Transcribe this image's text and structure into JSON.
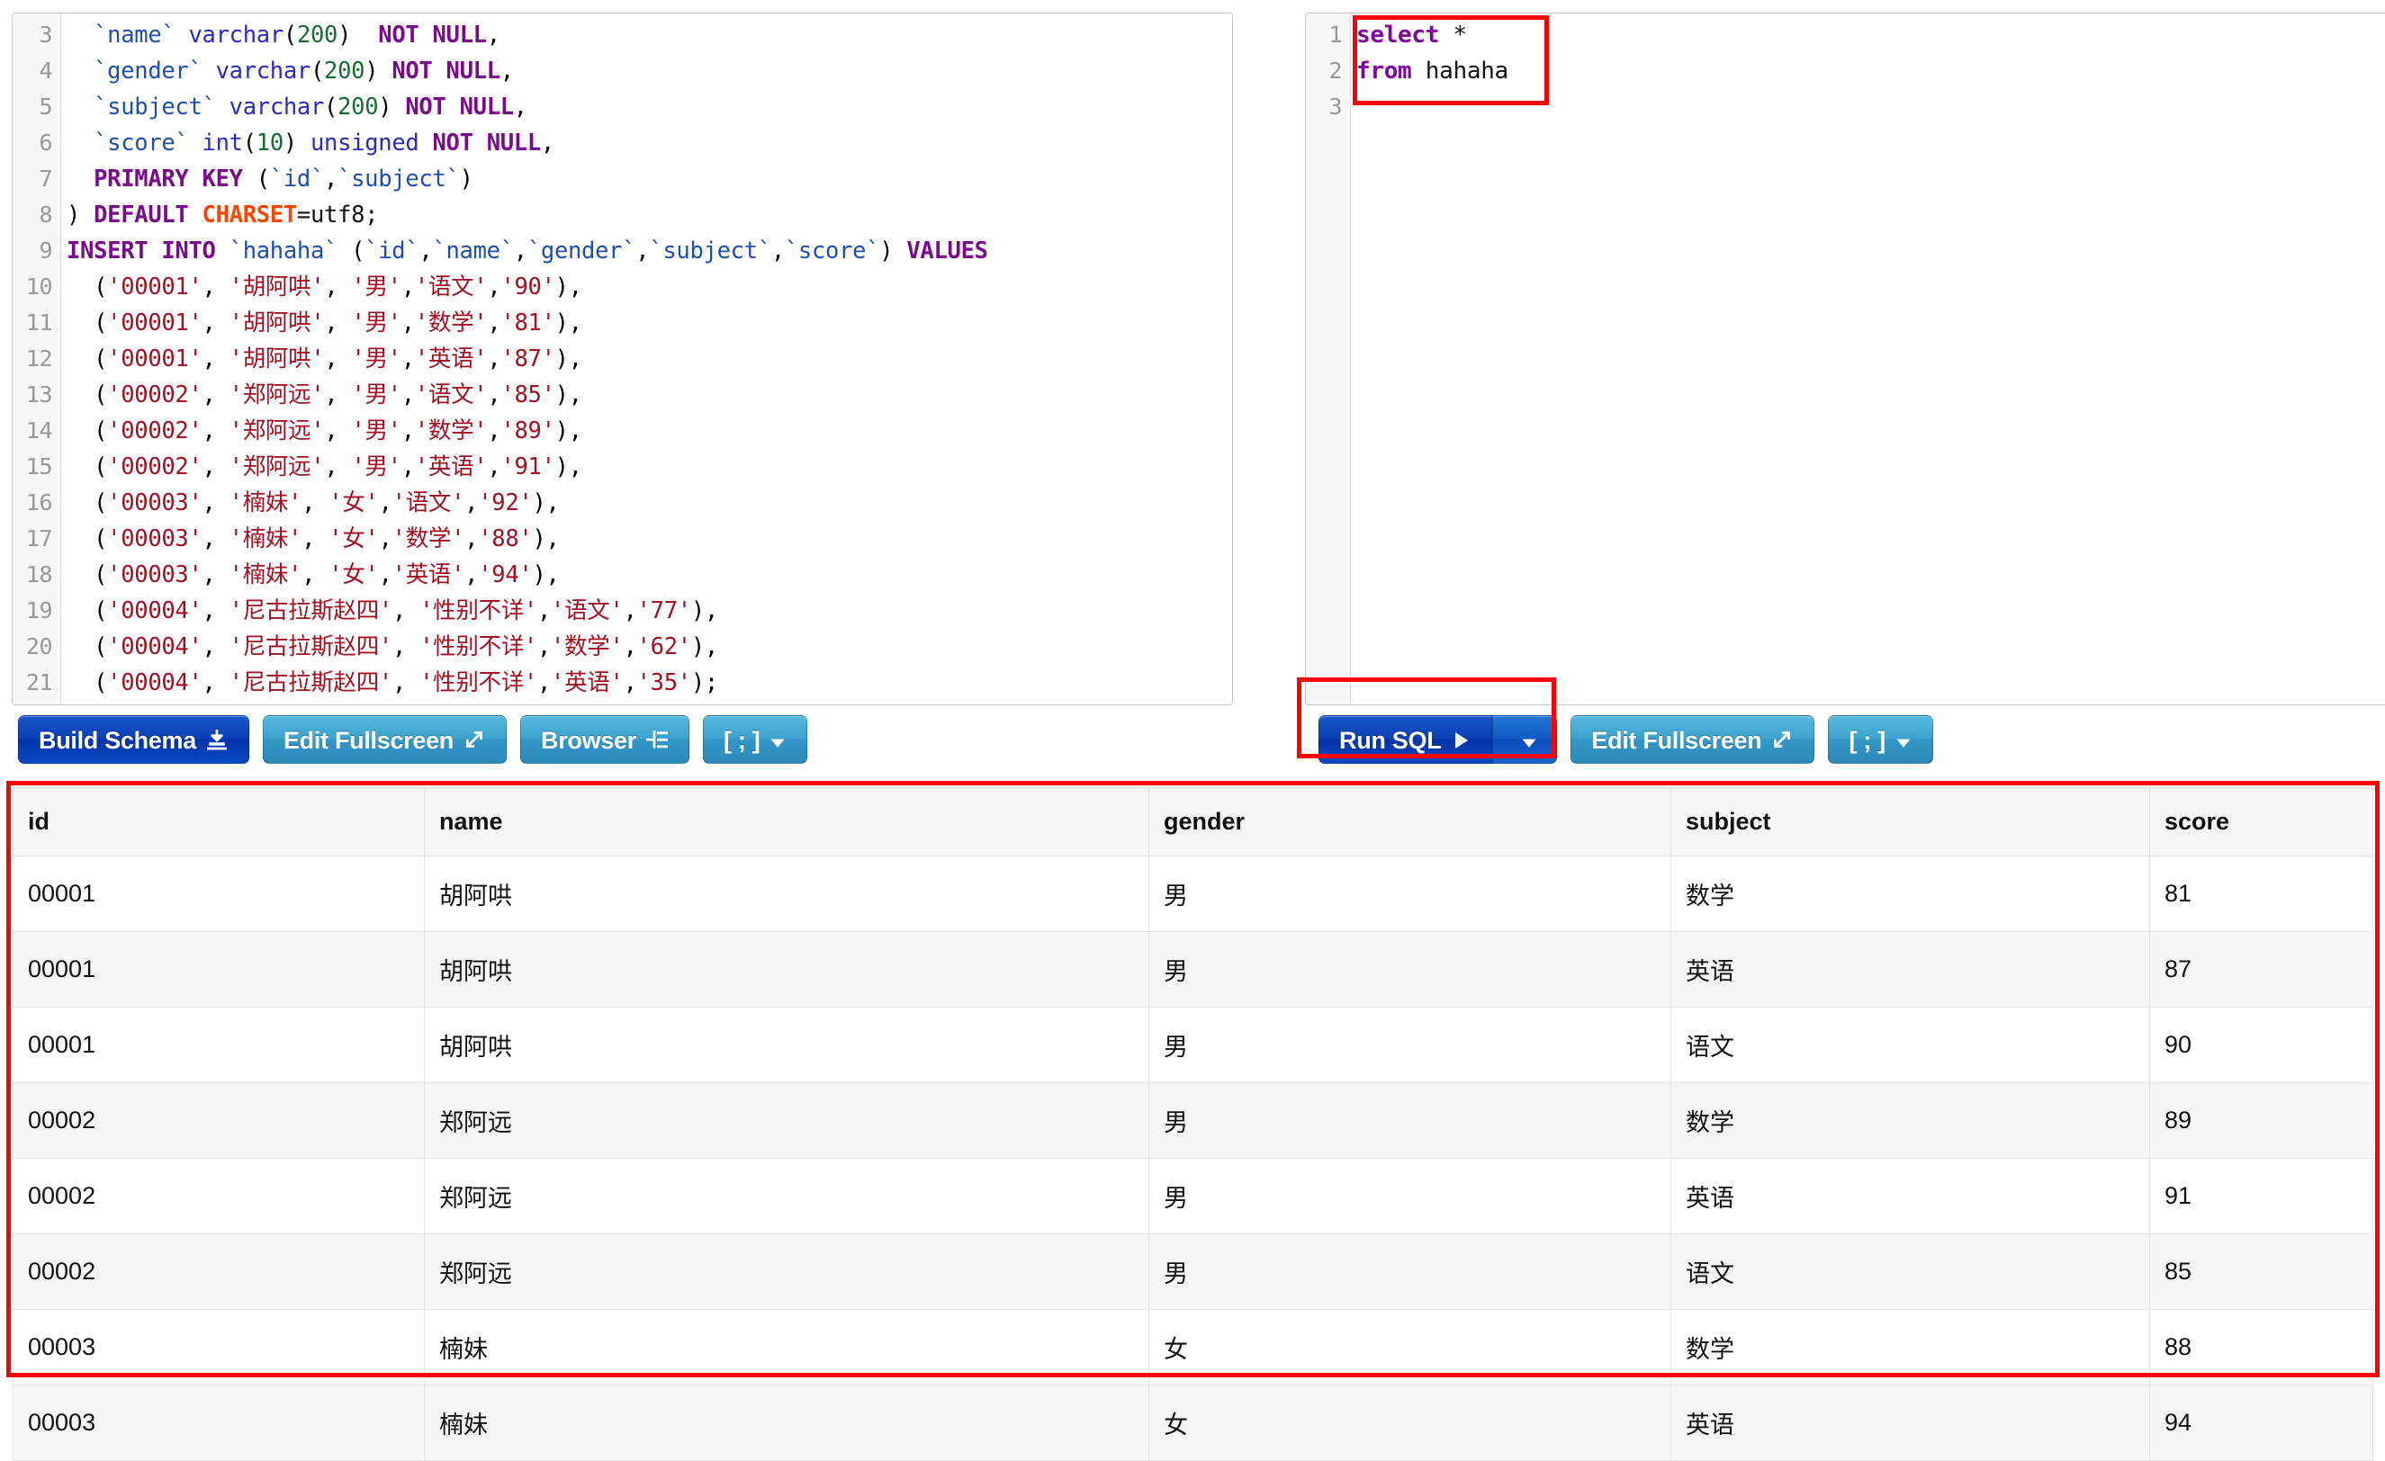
{
  "schema_editor": {
    "name": "schema-sql-editor",
    "first_line_number": 3,
    "lines": [
      {
        "n": 3,
        "tokens": [
          {
            "t": "  ",
            "c": "plain"
          },
          {
            "t": "`name`",
            "c": "ident"
          },
          {
            "t": " ",
            "c": "plain"
          },
          {
            "t": "varchar",
            "c": "type"
          },
          {
            "t": "(",
            "c": "punc"
          },
          {
            "t": "200",
            "c": "num"
          },
          {
            "t": ")",
            "c": "punc"
          },
          {
            "t": "  ",
            "c": "plain"
          },
          {
            "t": "NOT NULL",
            "c": "kw"
          },
          {
            "t": ",",
            "c": "punc"
          }
        ]
      },
      {
        "n": 4,
        "tokens": [
          {
            "t": "  ",
            "c": "plain"
          },
          {
            "t": "`gender`",
            "c": "ident"
          },
          {
            "t": " ",
            "c": "plain"
          },
          {
            "t": "varchar",
            "c": "type"
          },
          {
            "t": "(",
            "c": "punc"
          },
          {
            "t": "200",
            "c": "num"
          },
          {
            "t": ") ",
            "c": "punc"
          },
          {
            "t": "NOT NULL",
            "c": "kw"
          },
          {
            "t": ",",
            "c": "punc"
          }
        ]
      },
      {
        "n": 5,
        "tokens": [
          {
            "t": "  ",
            "c": "plain"
          },
          {
            "t": "`subject`",
            "c": "ident"
          },
          {
            "t": " ",
            "c": "plain"
          },
          {
            "t": "varchar",
            "c": "type"
          },
          {
            "t": "(",
            "c": "punc"
          },
          {
            "t": "200",
            "c": "num"
          },
          {
            "t": ") ",
            "c": "punc"
          },
          {
            "t": "NOT NULL",
            "c": "kw"
          },
          {
            "t": ",",
            "c": "punc"
          }
        ]
      },
      {
        "n": 6,
        "tokens": [
          {
            "t": "  ",
            "c": "plain"
          },
          {
            "t": "`score`",
            "c": "ident"
          },
          {
            "t": " ",
            "c": "plain"
          },
          {
            "t": "int",
            "c": "type"
          },
          {
            "t": "(",
            "c": "punc"
          },
          {
            "t": "10",
            "c": "num"
          },
          {
            "t": ") ",
            "c": "punc"
          },
          {
            "t": "unsigned",
            "c": "type"
          },
          {
            "t": " ",
            "c": "plain"
          },
          {
            "t": "NOT NULL",
            "c": "kw"
          },
          {
            "t": ",",
            "c": "punc"
          }
        ]
      },
      {
        "n": 7,
        "tokens": [
          {
            "t": "  ",
            "c": "plain"
          },
          {
            "t": "PRIMARY KEY",
            "c": "kw"
          },
          {
            "t": " (",
            "c": "punc"
          },
          {
            "t": "`id`",
            "c": "ident"
          },
          {
            "t": ",",
            "c": "punc"
          },
          {
            "t": "`subject`",
            "c": "ident"
          },
          {
            "t": ")",
            "c": "punc"
          }
        ]
      },
      {
        "n": 8,
        "tokens": [
          {
            "t": ") ",
            "c": "punc"
          },
          {
            "t": "DEFAULT",
            "c": "kw"
          },
          {
            "t": " ",
            "c": "plain"
          },
          {
            "t": "CHARSET",
            "c": "charset"
          },
          {
            "t": "=utf8;",
            "c": "plain"
          }
        ]
      },
      {
        "n": 9,
        "tokens": [
          {
            "t": "INSERT INTO",
            "c": "kw"
          },
          {
            "t": " ",
            "c": "plain"
          },
          {
            "t": "`hahaha`",
            "c": "ident"
          },
          {
            "t": " (",
            "c": "punc"
          },
          {
            "t": "`id`",
            "c": "ident"
          },
          {
            "t": ",",
            "c": "punc"
          },
          {
            "t": "`name`",
            "c": "ident"
          },
          {
            "t": ",",
            "c": "punc"
          },
          {
            "t": "`gender`",
            "c": "ident"
          },
          {
            "t": ",",
            "c": "punc"
          },
          {
            "t": "`subject`",
            "c": "ident"
          },
          {
            "t": ",",
            "c": "punc"
          },
          {
            "t": "`score`",
            "c": "ident"
          },
          {
            "t": ") ",
            "c": "punc"
          },
          {
            "t": "VALUES",
            "c": "kw"
          }
        ]
      },
      {
        "n": 10,
        "tokens": [
          {
            "t": "  (",
            "c": "punc"
          },
          {
            "t": "'00001'",
            "c": "str"
          },
          {
            "t": ", ",
            "c": "punc"
          },
          {
            "t": "'胡阿哄'",
            "c": "str"
          },
          {
            "t": ", ",
            "c": "punc"
          },
          {
            "t": "'男'",
            "c": "str"
          },
          {
            "t": ",",
            "c": "punc"
          },
          {
            "t": "'语文'",
            "c": "str"
          },
          {
            "t": ",",
            "c": "punc"
          },
          {
            "t": "'90'",
            "c": "str"
          },
          {
            "t": "),",
            "c": "punc"
          }
        ]
      },
      {
        "n": 11,
        "tokens": [
          {
            "t": "  (",
            "c": "punc"
          },
          {
            "t": "'00001'",
            "c": "str"
          },
          {
            "t": ", ",
            "c": "punc"
          },
          {
            "t": "'胡阿哄'",
            "c": "str"
          },
          {
            "t": ", ",
            "c": "punc"
          },
          {
            "t": "'男'",
            "c": "str"
          },
          {
            "t": ",",
            "c": "punc"
          },
          {
            "t": "'数学'",
            "c": "str"
          },
          {
            "t": ",",
            "c": "punc"
          },
          {
            "t": "'81'",
            "c": "str"
          },
          {
            "t": "),",
            "c": "punc"
          }
        ]
      },
      {
        "n": 12,
        "tokens": [
          {
            "t": "  (",
            "c": "punc"
          },
          {
            "t": "'00001'",
            "c": "str"
          },
          {
            "t": ", ",
            "c": "punc"
          },
          {
            "t": "'胡阿哄'",
            "c": "str"
          },
          {
            "t": ", ",
            "c": "punc"
          },
          {
            "t": "'男'",
            "c": "str"
          },
          {
            "t": ",",
            "c": "punc"
          },
          {
            "t": "'英语'",
            "c": "str"
          },
          {
            "t": ",",
            "c": "punc"
          },
          {
            "t": "'87'",
            "c": "str"
          },
          {
            "t": "),",
            "c": "punc"
          }
        ]
      },
      {
        "n": 13,
        "tokens": [
          {
            "t": "  (",
            "c": "punc"
          },
          {
            "t": "'00002'",
            "c": "str"
          },
          {
            "t": ", ",
            "c": "punc"
          },
          {
            "t": "'郑阿远'",
            "c": "str"
          },
          {
            "t": ", ",
            "c": "punc"
          },
          {
            "t": "'男'",
            "c": "str"
          },
          {
            "t": ",",
            "c": "punc"
          },
          {
            "t": "'语文'",
            "c": "str"
          },
          {
            "t": ",",
            "c": "punc"
          },
          {
            "t": "'85'",
            "c": "str"
          },
          {
            "t": "),",
            "c": "punc"
          }
        ]
      },
      {
        "n": 14,
        "tokens": [
          {
            "t": "  (",
            "c": "punc"
          },
          {
            "t": "'00002'",
            "c": "str"
          },
          {
            "t": ", ",
            "c": "punc"
          },
          {
            "t": "'郑阿远'",
            "c": "str"
          },
          {
            "t": ", ",
            "c": "punc"
          },
          {
            "t": "'男'",
            "c": "str"
          },
          {
            "t": ",",
            "c": "punc"
          },
          {
            "t": "'数学'",
            "c": "str"
          },
          {
            "t": ",",
            "c": "punc"
          },
          {
            "t": "'89'",
            "c": "str"
          },
          {
            "t": "),",
            "c": "punc"
          }
        ]
      },
      {
        "n": 15,
        "tokens": [
          {
            "t": "  (",
            "c": "punc"
          },
          {
            "t": "'00002'",
            "c": "str"
          },
          {
            "t": ", ",
            "c": "punc"
          },
          {
            "t": "'郑阿远'",
            "c": "str"
          },
          {
            "t": ", ",
            "c": "punc"
          },
          {
            "t": "'男'",
            "c": "str"
          },
          {
            "t": ",",
            "c": "punc"
          },
          {
            "t": "'英语'",
            "c": "str"
          },
          {
            "t": ",",
            "c": "punc"
          },
          {
            "t": "'91'",
            "c": "str"
          },
          {
            "t": "),",
            "c": "punc"
          }
        ]
      },
      {
        "n": 16,
        "tokens": [
          {
            "t": "  (",
            "c": "punc"
          },
          {
            "t": "'00003'",
            "c": "str"
          },
          {
            "t": ", ",
            "c": "punc"
          },
          {
            "t": "'楠妹'",
            "c": "str"
          },
          {
            "t": ", ",
            "c": "punc"
          },
          {
            "t": "'女'",
            "c": "str"
          },
          {
            "t": ",",
            "c": "punc"
          },
          {
            "t": "'语文'",
            "c": "str"
          },
          {
            "t": ",",
            "c": "punc"
          },
          {
            "t": "'92'",
            "c": "str"
          },
          {
            "t": "),",
            "c": "punc"
          }
        ]
      },
      {
        "n": 17,
        "tokens": [
          {
            "t": "  (",
            "c": "punc"
          },
          {
            "t": "'00003'",
            "c": "str"
          },
          {
            "t": ", ",
            "c": "punc"
          },
          {
            "t": "'楠妹'",
            "c": "str"
          },
          {
            "t": ", ",
            "c": "punc"
          },
          {
            "t": "'女'",
            "c": "str"
          },
          {
            "t": ",",
            "c": "punc"
          },
          {
            "t": "'数学'",
            "c": "str"
          },
          {
            "t": ",",
            "c": "punc"
          },
          {
            "t": "'88'",
            "c": "str"
          },
          {
            "t": "),",
            "c": "punc"
          }
        ]
      },
      {
        "n": 18,
        "tokens": [
          {
            "t": "  (",
            "c": "punc"
          },
          {
            "t": "'00003'",
            "c": "str"
          },
          {
            "t": ", ",
            "c": "punc"
          },
          {
            "t": "'楠妹'",
            "c": "str"
          },
          {
            "t": ", ",
            "c": "punc"
          },
          {
            "t": "'女'",
            "c": "str"
          },
          {
            "t": ",",
            "c": "punc"
          },
          {
            "t": "'英语'",
            "c": "str"
          },
          {
            "t": ",",
            "c": "punc"
          },
          {
            "t": "'94'",
            "c": "str"
          },
          {
            "t": "),",
            "c": "punc"
          }
        ]
      },
      {
        "n": 19,
        "tokens": [
          {
            "t": "  (",
            "c": "punc"
          },
          {
            "t": "'00004'",
            "c": "str"
          },
          {
            "t": ", ",
            "c": "punc"
          },
          {
            "t": "'尼古拉斯赵四'",
            "c": "str"
          },
          {
            "t": ", ",
            "c": "punc"
          },
          {
            "t": "'性别不详'",
            "c": "str"
          },
          {
            "t": ",",
            "c": "punc"
          },
          {
            "t": "'语文'",
            "c": "str"
          },
          {
            "t": ",",
            "c": "punc"
          },
          {
            "t": "'77'",
            "c": "str"
          },
          {
            "t": "),",
            "c": "punc"
          }
        ]
      },
      {
        "n": 20,
        "tokens": [
          {
            "t": "  (",
            "c": "punc"
          },
          {
            "t": "'00004'",
            "c": "str"
          },
          {
            "t": ", ",
            "c": "punc"
          },
          {
            "t": "'尼古拉斯赵四'",
            "c": "str"
          },
          {
            "t": ", ",
            "c": "punc"
          },
          {
            "t": "'性别不详'",
            "c": "str"
          },
          {
            "t": ",",
            "c": "punc"
          },
          {
            "t": "'数学'",
            "c": "str"
          },
          {
            "t": ",",
            "c": "punc"
          },
          {
            "t": "'62'",
            "c": "str"
          },
          {
            "t": "),",
            "c": "punc"
          }
        ]
      },
      {
        "n": 21,
        "tokens": [
          {
            "t": "  (",
            "c": "punc"
          },
          {
            "t": "'00004'",
            "c": "str"
          },
          {
            "t": ", ",
            "c": "punc"
          },
          {
            "t": "'尼古拉斯赵四'",
            "c": "str"
          },
          {
            "t": ", ",
            "c": "punc"
          },
          {
            "t": "'性别不详'",
            "c": "str"
          },
          {
            "t": ",",
            "c": "punc"
          },
          {
            "t": "'英语'",
            "c": "str"
          },
          {
            "t": ",",
            "c": "punc"
          },
          {
            "t": "'35'",
            "c": "str"
          },
          {
            "t": ");",
            "c": "punc"
          }
        ]
      }
    ]
  },
  "query_editor": {
    "name": "query-sql-editor",
    "lines": [
      {
        "n": 1,
        "tokens": [
          {
            "t": "select",
            "c": "kwq"
          },
          {
            "t": " *",
            "c": "plain"
          }
        ]
      },
      {
        "n": 2,
        "tokens": [
          {
            "t": "from",
            "c": "kwq"
          },
          {
            "t": " hahaha",
            "c": "plain"
          }
        ]
      },
      {
        "n": 3,
        "tokens": []
      }
    ]
  },
  "toolbar_left": {
    "buttons": [
      {
        "label": "Build Schema",
        "icon": "download-stamp-icon",
        "style": "dark"
      },
      {
        "label": "Edit Fullscreen",
        "icon": "expand-arrows-icon",
        "style": "light"
      },
      {
        "label": "Browser",
        "icon": "list-indent-icon",
        "style": "light"
      },
      {
        "label": "[ ; ]",
        "icon": "caret-down-icon",
        "style": "light"
      }
    ]
  },
  "toolbar_right": {
    "run_sql": {
      "label": "Run SQL",
      "icon": "play-triangle-icon",
      "caret_icon": "caret-down-icon"
    },
    "buttons": [
      {
        "label": "Edit Fullscreen",
        "icon": "expand-arrows-icon",
        "style": "light"
      },
      {
        "label": "[ ; ]",
        "icon": "caret-down-icon",
        "style": "light"
      }
    ]
  },
  "results": {
    "name": "sql-results-table",
    "columns": [
      "id",
      "name",
      "gender",
      "subject",
      "score"
    ],
    "rows": [
      [
        "00001",
        "胡阿哄",
        "男",
        "数学",
        "81"
      ],
      [
        "00001",
        "胡阿哄",
        "男",
        "英语",
        "87"
      ],
      [
        "00001",
        "胡阿哄",
        "男",
        "语文",
        "90"
      ],
      [
        "00002",
        "郑阿远",
        "男",
        "数学",
        "89"
      ],
      [
        "00002",
        "郑阿远",
        "男",
        "英语",
        "91"
      ],
      [
        "00002",
        "郑阿远",
        "男",
        "语文",
        "85"
      ],
      [
        "00003",
        "楠妹",
        "女",
        "数学",
        "88"
      ],
      [
        "00003",
        "楠妹",
        "女",
        "英语",
        "94"
      ]
    ]
  },
  "annotations": {
    "color": "#ff0000",
    "boxes": [
      "query-text-highlight",
      "run-sql-button-highlight",
      "results-table-highlight"
    ]
  },
  "colors": {
    "accent_dark_blue": "#0b3fb5",
    "accent_light_blue": "#3397c6",
    "annotation_red": "#ff0000",
    "keyword_purple": "#7a0a8c",
    "identifier_blue": "#1d4fb0",
    "string_red": "#a31020",
    "number_green": "#1a6b33",
    "charset_orange": "#ff4500"
  }
}
